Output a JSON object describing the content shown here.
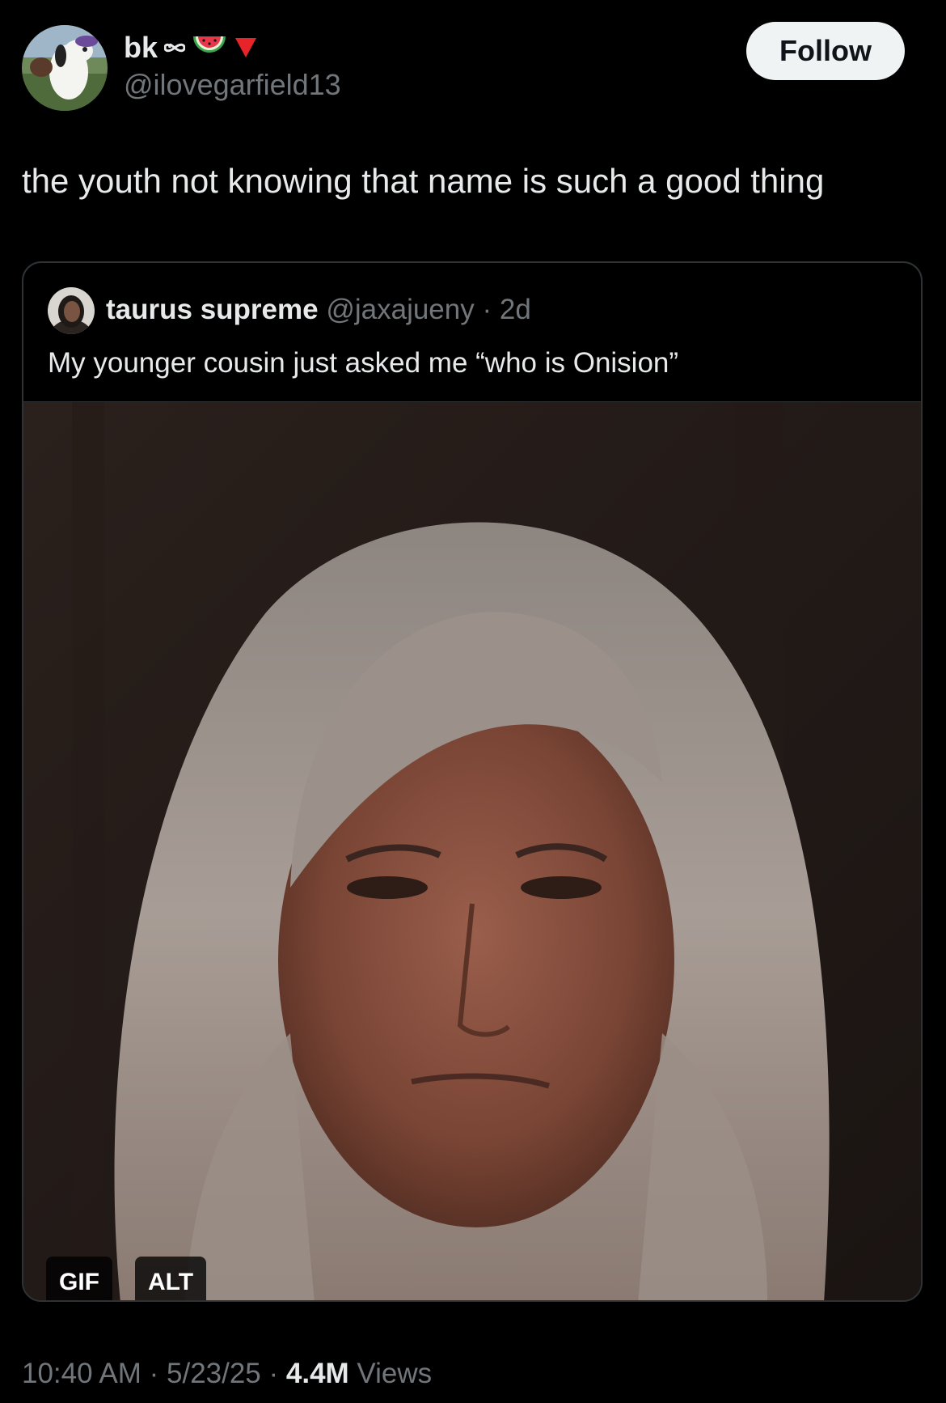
{
  "author": {
    "display_name": "bk",
    "name_emojis": [
      "infinity-icon",
      "watermelon-icon",
      "red-triangle-icon"
    ],
    "handle": "@ilovegarfield13",
    "avatar": "snoopy-avatar-icon"
  },
  "follow_button": {
    "label": "Follow"
  },
  "tweet": {
    "text": "the youth not knowing that name is such a good thing"
  },
  "quote": {
    "display_name": "taurus supreme",
    "handle": "@jaxajueny",
    "separator": "·",
    "time": "2d",
    "text": "My younger cousin just asked me “who is Onision”",
    "media": {
      "type": "gif",
      "gif_badge": "GIF",
      "alt_badge": "ALT"
    }
  },
  "footer": {
    "time": "10:40 AM",
    "sep1": " · ",
    "date": "5/23/25",
    "sep2": " · ",
    "views_count": "4.4M",
    "views_label": " Views"
  },
  "colors": {
    "background": "#000000",
    "text_primary": "#e7e9ea",
    "text_secondary": "#71767b",
    "border": "#2f3336",
    "follow_bg": "#eff3f4",
    "follow_text": "#0f1419"
  }
}
